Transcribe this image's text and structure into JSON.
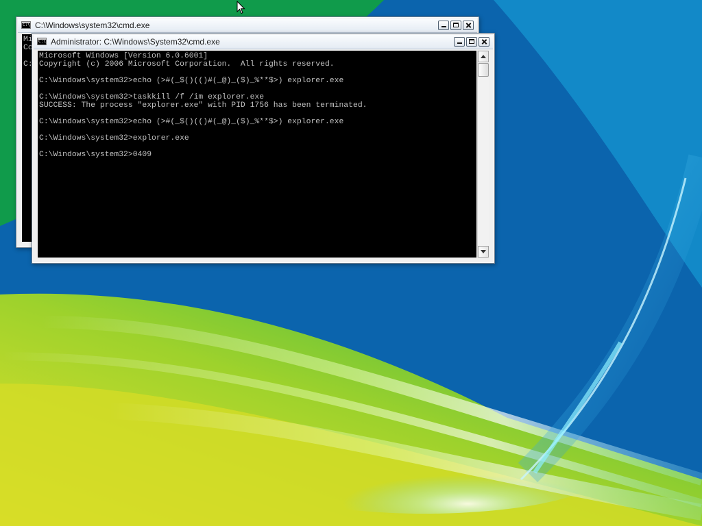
{
  "desktop": {
    "wallpaper": "aurora-wallpaper",
    "colors": {
      "green": "#18a43a",
      "blue": "#0a5da8",
      "cyan": "#0e9ad2",
      "yellow": "#d7e02a"
    }
  },
  "back_window": {
    "title": "C:\\Windows\\system32\\cmd.exe",
    "console_lines": [
      "Mi",
      "Co",
      "",
      "C:"
    ]
  },
  "front_window": {
    "title": "Administrator: C:\\Windows\\System32\\cmd.exe",
    "console_lines": [
      "Microsoft Windows [Version 6.0.6001]",
      "Copyright (c) 2006 Microsoft Corporation.  All rights reserved.",
      "",
      "C:\\Windows\\system32>echo (>#(_$()(()#(_@)_($)_%**$>) explorer.exe",
      "",
      "C:\\Windows\\system32>taskkill /f /im explorer.exe",
      "SUCCESS: The process \"explorer.exe\" with PID 1756 has been terminated.",
      "",
      "C:\\Windows\\system32>echo (>#(_$()(()#(_@)_($)_%**$>) explorer.exe",
      "",
      "C:\\Windows\\system32>explorer.exe",
      "",
      "C:\\Windows\\system32>0409"
    ]
  },
  "console_colors": {
    "background": "#000000",
    "text": "#c0c0c0"
  },
  "icons": {
    "window_icon": "cmd-icon",
    "minimize": "minimize-icon",
    "maximize": "maximize-icon",
    "close": "close-icon",
    "scroll_up": "arrow-up-icon",
    "scroll_down": "arrow-down-icon",
    "pointer": "mouse-pointer-icon"
  }
}
